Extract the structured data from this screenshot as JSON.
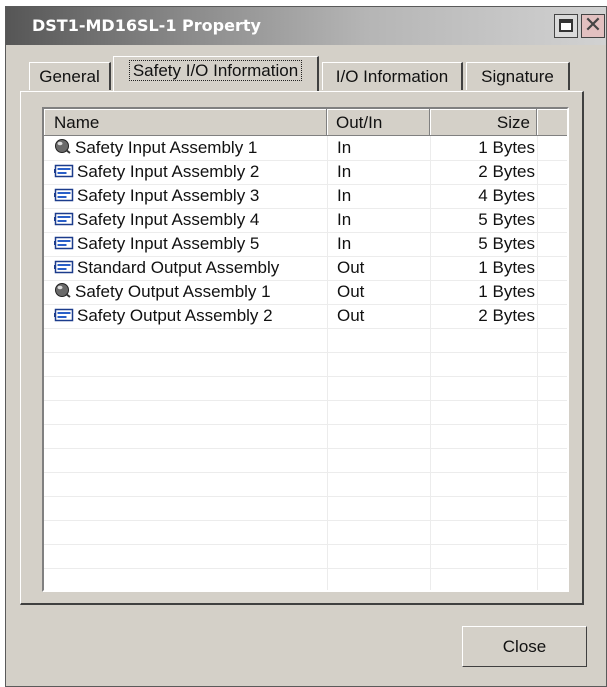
{
  "window": {
    "title": "DST1-MD16SL-1 Property"
  },
  "titlebar_buttons": {
    "maximize_icon": "maximize-icon",
    "close_icon": "close-icon",
    "close_glyph": "✕"
  },
  "tabs": [
    {
      "label": "General",
      "active": false
    },
    {
      "label": "Safety I/O Information",
      "active": true
    },
    {
      "label": "I/O Information",
      "active": false
    },
    {
      "label": "Signature",
      "active": false
    }
  ],
  "table": {
    "columns": [
      "Name",
      "Out/In",
      "Size"
    ],
    "rows": [
      {
        "icon": "safety-sphere-icon",
        "name": "Safety Input Assembly 1",
        "dir": "In",
        "size": "1 Bytes"
      },
      {
        "icon": "io-card-icon",
        "name": "Safety Input Assembly 2",
        "dir": "In",
        "size": "2 Bytes"
      },
      {
        "icon": "io-card-icon",
        "name": "Safety Input Assembly 3",
        "dir": "In",
        "size": "4 Bytes"
      },
      {
        "icon": "io-card-icon",
        "name": "Safety Input Assembly 4",
        "dir": "In",
        "size": "5 Bytes"
      },
      {
        "icon": "io-card-icon",
        "name": "Safety Input Assembly 5",
        "dir": "In",
        "size": "5 Bytes"
      },
      {
        "icon": "io-card-icon",
        "name": "Standard Output Assembly",
        "dir": "Out",
        "size": "1 Bytes"
      },
      {
        "icon": "safety-sphere-icon",
        "name": "Safety Output Assembly 1",
        "dir": "Out",
        "size": "1 Bytes"
      },
      {
        "icon": "io-card-icon",
        "name": "Safety Output Assembly 2",
        "dir": "Out",
        "size": "2 Bytes"
      }
    ]
  },
  "footer": {
    "close_label": "Close"
  },
  "colors": {
    "dialog_bg": "#d4d0c8",
    "list_bg": "#ffffff",
    "row_line": "#ececec"
  }
}
